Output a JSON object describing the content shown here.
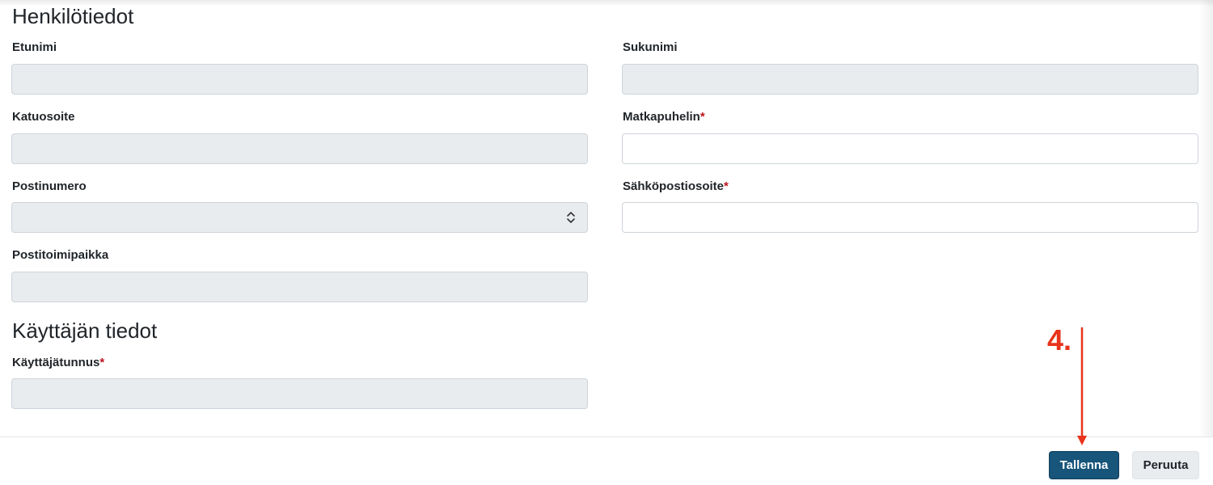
{
  "sections": {
    "personal": "Henkilötiedot",
    "user": "Käyttäjän tiedot"
  },
  "fields": {
    "first_name": {
      "label": "Etunimi",
      "value": "",
      "disabled": true
    },
    "last_name": {
      "label": "Sukunimi",
      "value": "",
      "disabled": true
    },
    "street": {
      "label": "Katuosoite",
      "value": "",
      "disabled": true
    },
    "mobile": {
      "label": "Matkapuhelin",
      "required_mark": "*",
      "value": "",
      "disabled": false
    },
    "postal_code": {
      "label": "Postinumero",
      "value": "",
      "disabled": true
    },
    "email": {
      "label": "Sähköpostiosoite",
      "required_mark": "*",
      "value": "",
      "disabled": false
    },
    "city": {
      "label": "Postitoimipaikka",
      "value": "",
      "disabled": true
    },
    "username": {
      "label": "Käyttäjätunnus",
      "required_mark": "*",
      "value": "",
      "disabled": true
    }
  },
  "buttons": {
    "save": "Tallenna",
    "cancel": "Peruuta"
  },
  "annotation": {
    "step_label": "4.",
    "color": "#e8341c"
  },
  "colors": {
    "primary": "#17557a",
    "required": "#c0141c",
    "disabled_bg": "#e9ecef"
  }
}
